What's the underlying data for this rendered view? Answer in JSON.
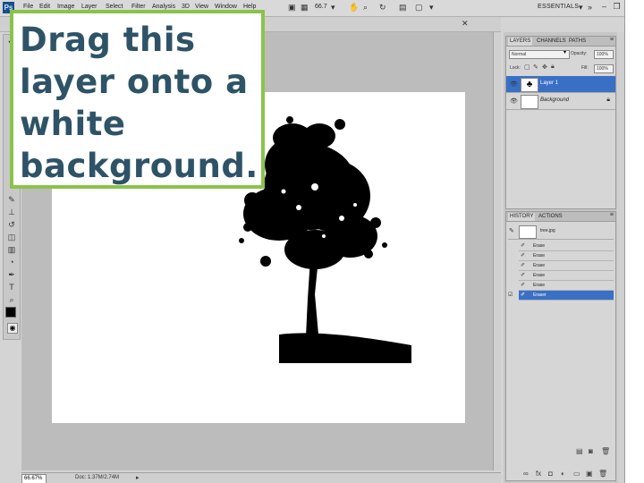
{
  "menubar": {
    "logo": "Ps",
    "items": [
      "File",
      "Edit",
      "Image",
      "Layer",
      "Select",
      "Filter",
      "Analysis",
      "3D",
      "View",
      "Window",
      "Help"
    ],
    "zoom": "66.7",
    "workspace": "ESSENTIALS"
  },
  "callout": {
    "text": "Drag this\nlayer onto a\nwhite\nbackground."
  },
  "layers_panel": {
    "tabs": [
      "LAYERS",
      "CHANNELS",
      "PATHS"
    ],
    "blend_mode": "Normal",
    "opacity_label": "Opacity:",
    "opacity": "100%",
    "lock_label": "Lock:",
    "fill_label": "Fill:",
    "fill": "100%",
    "layers": [
      {
        "name": "Layer 1",
        "selected": true
      },
      {
        "name": "Background",
        "selected": false,
        "locked": true
      }
    ]
  },
  "history_panel": {
    "tabs": [
      "HISTORY",
      "ACTIONS"
    ],
    "snapshot": "tree.jpg",
    "steps": [
      {
        "label": "Erase"
      },
      {
        "label": "Erase"
      },
      {
        "label": "Erase"
      },
      {
        "label": "Erase"
      },
      {
        "label": "Erase"
      },
      {
        "label": "Eraser",
        "selected": true
      }
    ]
  },
  "statusbar": {
    "zoom": "66.67%",
    "doc_info": "Doc: 1.37M/2.74M"
  },
  "colors": {
    "callout_border": "#8bc34a",
    "callout_text": "#2e5367",
    "selection": "#3a6fc6"
  }
}
